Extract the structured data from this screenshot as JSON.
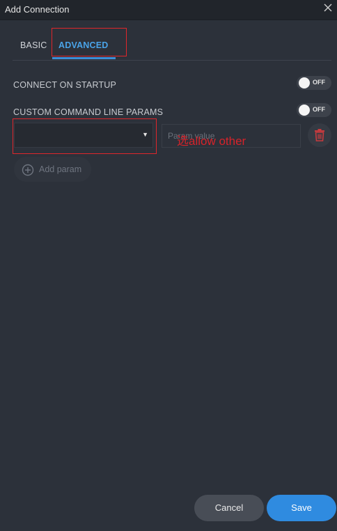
{
  "window": {
    "title": "Add Connection"
  },
  "tabs": [
    {
      "label": "BASIC",
      "active": false
    },
    {
      "label": "ADVANCED",
      "active": true
    }
  ],
  "settings": {
    "connect_on_startup": {
      "label": "CONNECT ON STARTUP",
      "toggle_text": "OFF",
      "on": false
    },
    "custom_params": {
      "label": "CUSTOM COMMAND LINE PARAMS",
      "toggle_text": "OFF",
      "on": false
    }
  },
  "param_row": {
    "select_value": "",
    "value_placeholder": "Param value"
  },
  "annotation": {
    "text": "选allow other"
  },
  "add_param": {
    "label": "Add param"
  },
  "footer": {
    "cancel_label": "Cancel",
    "save_label": "Save"
  },
  "colors": {
    "background": "#2c313a",
    "accent": "#2f8be0",
    "annotation_red": "#e0262b",
    "delete_red": "#c93a3e"
  },
  "icons": {
    "close": "close-icon",
    "dropdown": "caret-down-icon",
    "delete": "trash-icon",
    "add": "plus-circle-icon"
  }
}
